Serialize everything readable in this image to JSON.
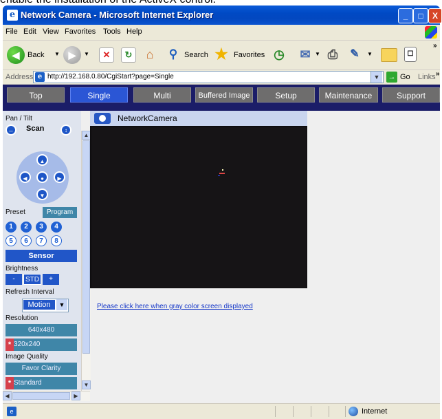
{
  "caption": "enable the installation of the ActiveX control.",
  "window": {
    "title": "Network Camera - Microsoft Internet Explorer",
    "min": "_",
    "max": "□",
    "close": "X"
  },
  "menu": [
    "File",
    "Edit",
    "View",
    "Favorites",
    "Tools",
    "Help"
  ],
  "toolbar": {
    "back": "Back",
    "search": "Search",
    "favorites": "Favorites",
    "more": "»"
  },
  "address": {
    "label": "Address",
    "url": "http://192.168.0.80/CgiStart?page=Single",
    "go": "Go",
    "links": "Links",
    "more": "»"
  },
  "tabs": [
    "Top",
    "Single",
    "Multi",
    "Buffered Image",
    "Setup",
    "Maintenance",
    "Support"
  ],
  "active_tab": "Single",
  "panel": {
    "pan_tilt": "Pan / Tilt",
    "scan": "Scan",
    "preset": "Preset",
    "program": "Program",
    "presets": [
      "1",
      "2",
      "3",
      "4",
      "5",
      "6",
      "7",
      "8"
    ],
    "sensor": "Sensor",
    "brightness": "Brightness",
    "bright_minus": "-",
    "bright_std": "STD",
    "bright_plus": "+",
    "refresh_interval": "Refresh Interval",
    "refresh_value": "Motion",
    "resolution": "Resolution",
    "res_high": "640x480",
    "res_low": "320x240",
    "image_quality": "Image Quality",
    "quality_clarity": "Favor Clarity",
    "quality_standard": "Standard",
    "selected_mark": "*"
  },
  "camera": {
    "title": "NetworkCamera",
    "gray_link": "Please click here when gray color screen displayed"
  },
  "status": {
    "zone": "Internet"
  },
  "colors": {
    "tab_bar": "#1b1d68",
    "tab_active": "#2b56d5",
    "panel_blue": "#2156c8",
    "selected_red": "#d6404c"
  }
}
